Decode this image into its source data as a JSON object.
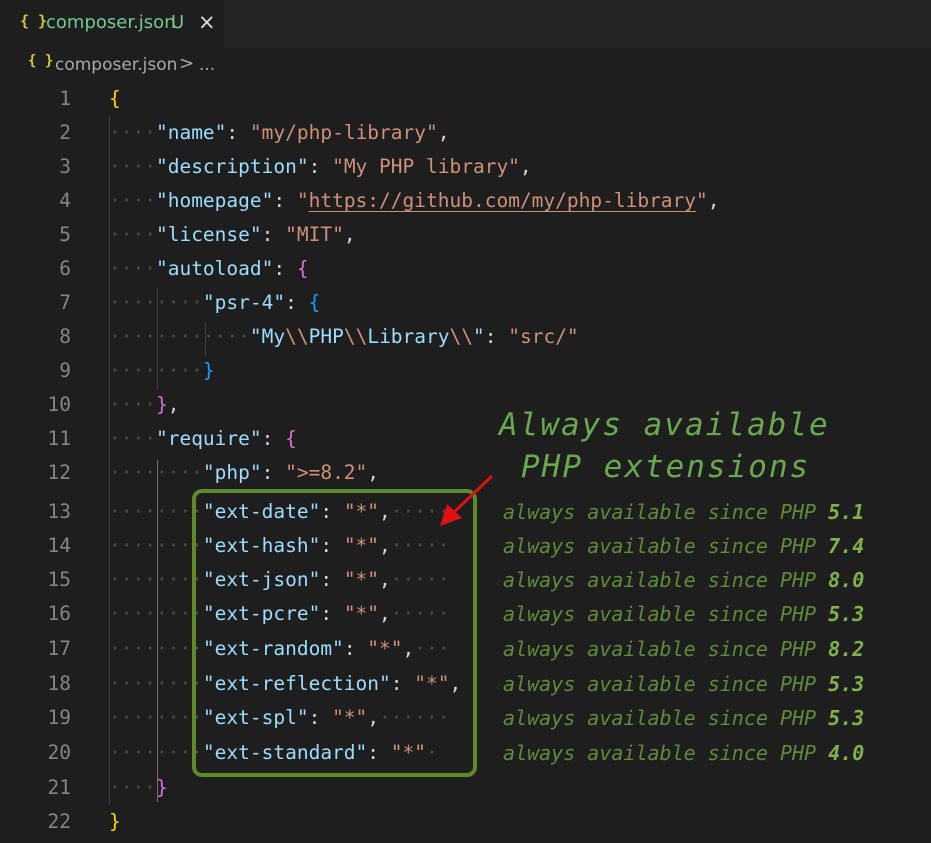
{
  "tab": {
    "icon": "{ }",
    "filename": "composer.json",
    "status": "U",
    "close_icon": "close-icon"
  },
  "breadcrumb": {
    "icon": "{ }",
    "file": "composer.json",
    "separator": ">",
    "more": "..."
  },
  "lines": [
    {
      "n": "1"
    },
    {
      "n": "2"
    },
    {
      "n": "3"
    },
    {
      "n": "4"
    },
    {
      "n": "5"
    },
    {
      "n": "6"
    },
    {
      "n": "7"
    },
    {
      "n": "8"
    },
    {
      "n": "9"
    },
    {
      "n": "10"
    },
    {
      "n": "11"
    },
    {
      "n": "12"
    },
    {
      "n": "13"
    },
    {
      "n": "14"
    },
    {
      "n": "15"
    },
    {
      "n": "16"
    },
    {
      "n": "17"
    },
    {
      "n": "18"
    },
    {
      "n": "19"
    },
    {
      "n": "20"
    },
    {
      "n": "21"
    },
    {
      "n": "22"
    }
  ],
  "code": {
    "name_key": "\"name\"",
    "name_val": "\"my/php-library\"",
    "desc_key": "\"description\"",
    "desc_val": "\"My PHP library\"",
    "home_key": "\"homepage\"",
    "home_q1": "\"",
    "home_url": "https://github.com/my/php-library",
    "home_q2": "\"",
    "license_key": "\"license\"",
    "license_val": "\"MIT\"",
    "autoload_key": "\"autoload\"",
    "psr_key": "\"psr-4\"",
    "ns_q1": "\"My",
    "ns_e1": "\\\\",
    "ns_p1": "PHP",
    "ns_e2": "\\\\",
    "ns_p2": "Library",
    "ns_e3": "\\\\",
    "ns_q2": "\"",
    "ns_val": "\"src/\"",
    "require_key": "\"require\"",
    "php_key": "\"php\"",
    "php_val": "\">=8.2\"",
    "requires": [
      {
        "key": "\"ext-date\"",
        "val": "\"*\""
      },
      {
        "key": "\"ext-hash\"",
        "val": "\"*\""
      },
      {
        "key": "\"ext-json\"",
        "val": "\"*\""
      },
      {
        "key": "\"ext-pcre\"",
        "val": "\"*\""
      },
      {
        "key": "\"ext-random\"",
        "val": "\"*\""
      },
      {
        "key": "\"ext-reflection\"",
        "val": "\"*\""
      },
      {
        "key": "\"ext-spl\"",
        "val": "\"*\""
      },
      {
        "key": "\"ext-standard\"",
        "val": "\"*\""
      }
    ]
  },
  "annotation": {
    "title_line1": "Always available",
    "title_line2": "PHP extensions",
    "note_prefix": "always available since PHP",
    "versions": [
      "5.1",
      "7.4",
      "8.0",
      "5.3",
      "8.2",
      "5.3",
      "5.3",
      "4.0"
    ],
    "box_color": "#5e8a2c",
    "arrow_color": "#e01010"
  }
}
